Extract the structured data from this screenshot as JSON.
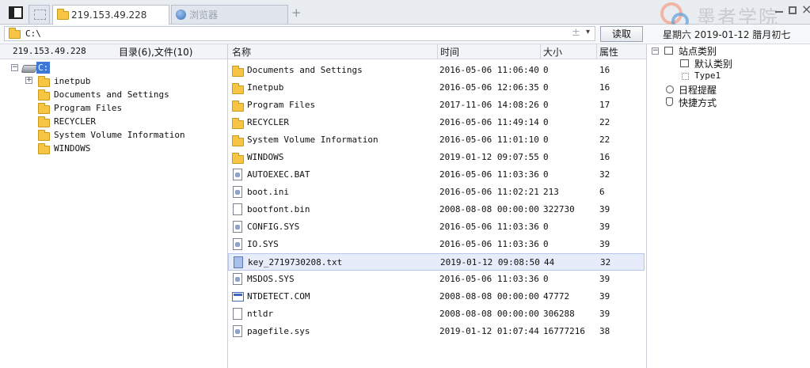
{
  "tabs": [
    {
      "label": ""
    },
    {
      "label": "219.153.49.228"
    },
    {
      "label": "浏览器"
    }
  ],
  "address": {
    "value": "C:\\",
    "read_button": "读取"
  },
  "header_right": {
    "date": "星期六 2019-01-12 腊月初七"
  },
  "watermark": {
    "text": "墨者学院"
  },
  "left_panel": {
    "host": "219.153.49.228",
    "summary": "目录(6),文件(10)",
    "root": "C:",
    "folders": [
      "inetpub",
      "Documents and Settings",
      "Program Files",
      "RECYCLER",
      "System Volume Information",
      "WINDOWS"
    ]
  },
  "file_list": {
    "columns": {
      "name": "名称",
      "time": "时间",
      "size": "大小",
      "attr": "属性"
    },
    "rows": [
      {
        "name": "Documents and Settings",
        "time": "2016-05-06 11:06:40",
        "size": "0",
        "attr": "16",
        "type": "folder"
      },
      {
        "name": "Inetpub",
        "time": "2016-05-06 12:06:35",
        "size": "0",
        "attr": "16",
        "type": "folder"
      },
      {
        "name": "Program Files",
        "time": "2017-11-06 14:08:26",
        "size": "0",
        "attr": "17",
        "type": "folder"
      },
      {
        "name": "RECYCLER",
        "time": "2016-05-06 11:49:14",
        "size": "0",
        "attr": "22",
        "type": "folder"
      },
      {
        "name": "System Volume Information",
        "time": "2016-05-06 11:01:10",
        "size": "0",
        "attr": "22",
        "type": "folder"
      },
      {
        "name": "WINDOWS",
        "time": "2019-01-12 09:07:55",
        "size": "0",
        "attr": "16",
        "type": "folder"
      },
      {
        "name": "AUTOEXEC.BAT",
        "time": "2016-05-06 11:03:36",
        "size": "0",
        "attr": "32",
        "type": "sys"
      },
      {
        "name": "boot.ini",
        "time": "2016-05-06 11:02:21",
        "size": "213",
        "attr": "6",
        "type": "sys"
      },
      {
        "name": "bootfont.bin",
        "time": "2008-08-08 00:00:00",
        "size": "322730",
        "attr": "39",
        "type": "file"
      },
      {
        "name": "CONFIG.SYS",
        "time": "2016-05-06 11:03:36",
        "size": "0",
        "attr": "39",
        "type": "sys"
      },
      {
        "name": "IO.SYS",
        "time": "2016-05-06 11:03:36",
        "size": "0",
        "attr": "39",
        "type": "sys"
      },
      {
        "name": "key_2719730208.txt",
        "time": "2019-01-12 09:08:50",
        "size": "44",
        "attr": "32",
        "type": "txt",
        "selected": true
      },
      {
        "name": "MSDOS.SYS",
        "time": "2016-05-06 11:03:36",
        "size": "0",
        "attr": "39",
        "type": "sys"
      },
      {
        "name": "NTDETECT.COM",
        "time": "2008-08-08 00:00:00",
        "size": "47772",
        "attr": "39",
        "type": "com"
      },
      {
        "name": "ntldr",
        "time": "2008-08-08 00:00:00",
        "size": "306288",
        "attr": "39",
        "type": "file"
      },
      {
        "name": "pagefile.sys",
        "time": "2019-01-12 01:07:44",
        "size": "16777216",
        "attr": "38",
        "type": "sys"
      }
    ]
  },
  "right_panel": {
    "site_category": "站点类别",
    "default_category": "默认类别",
    "type1": "Type1",
    "schedule": "日程提醒",
    "shortcuts": "快捷方式"
  }
}
